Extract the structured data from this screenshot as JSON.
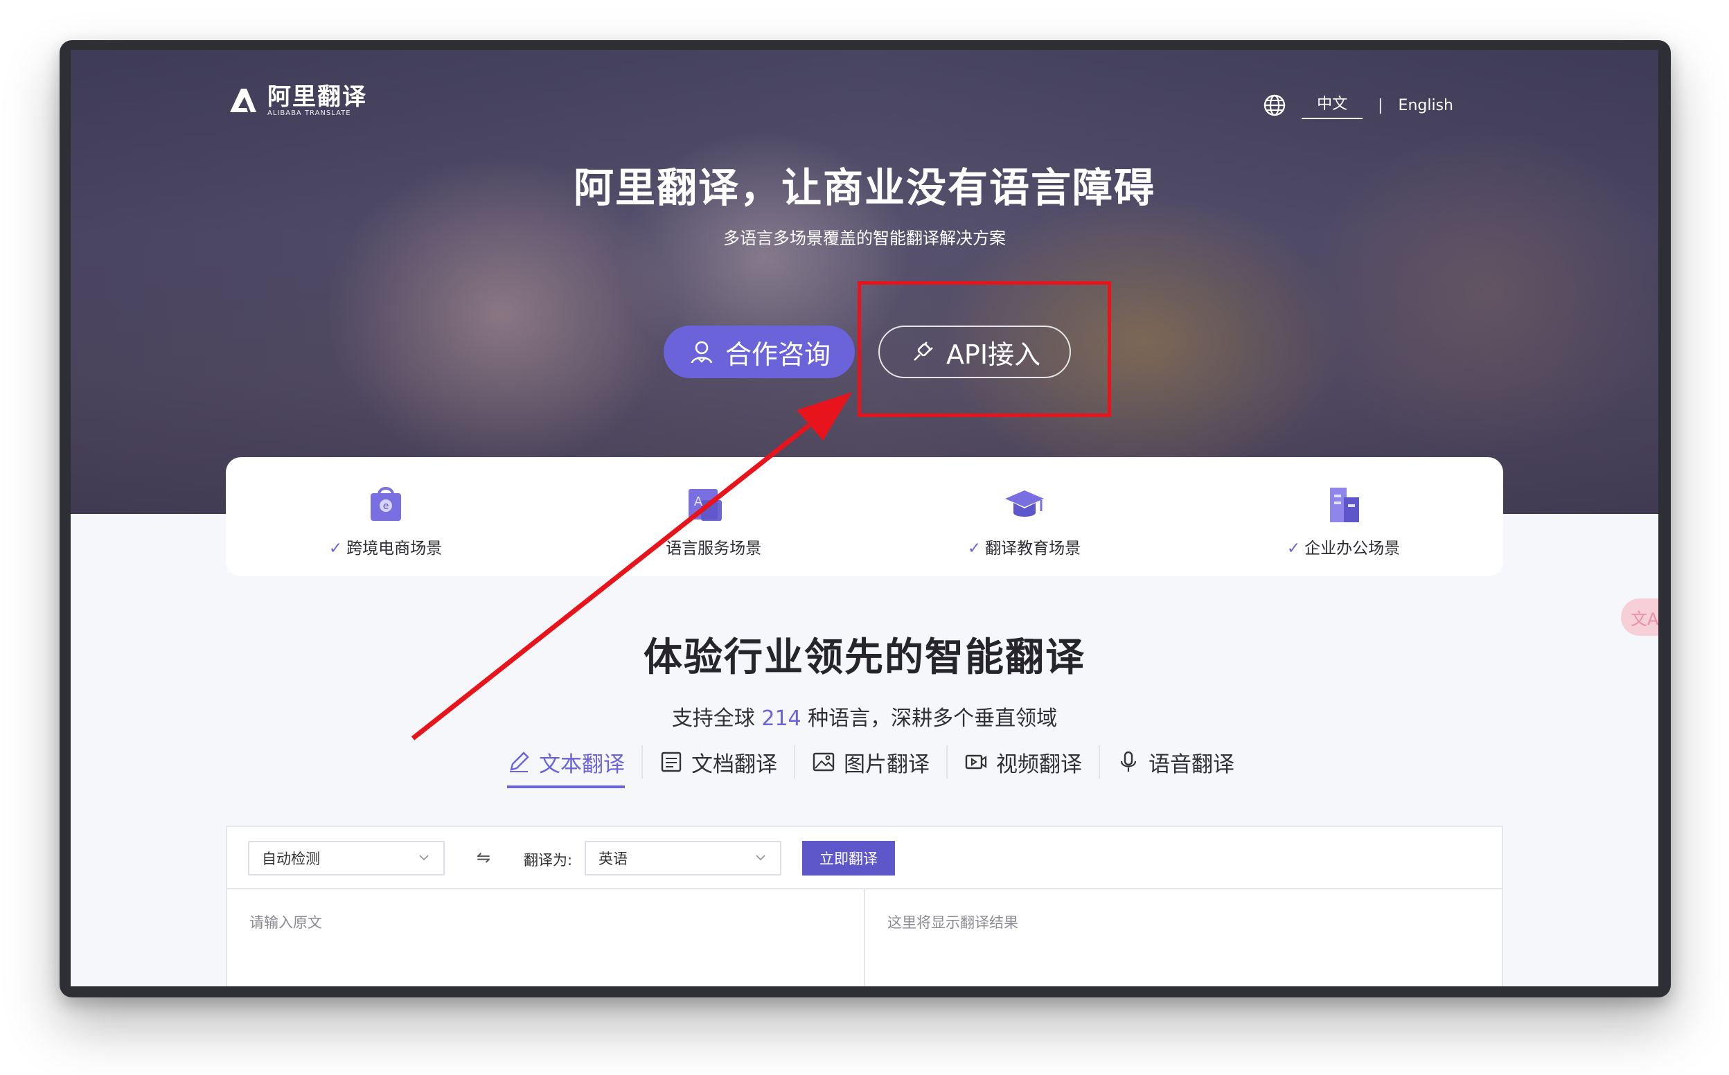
{
  "brand": {
    "name_cn": "阿里翻译",
    "name_en": "ALIBABA TRANSLATE"
  },
  "lang_switch": {
    "current": "中文",
    "separator": "|",
    "other": "English"
  },
  "hero": {
    "title": "阿里翻译，让商业没有语言障碍",
    "subtitle": "多语言多场景覆盖的智能翻译解决方案",
    "consult_label": "合作咨询",
    "api_label": "API接入"
  },
  "scenarios": [
    {
      "label": "跨境电商场景",
      "icon": "shopping-bag-icon"
    },
    {
      "label": "语言服务场景",
      "icon": "language-book-icon"
    },
    {
      "label": "翻译教育场景",
      "icon": "graduation-cap-icon"
    },
    {
      "label": "企业办公场景",
      "icon": "office-building-icon"
    }
  ],
  "side_float_label": "文A",
  "section": {
    "title": "体验行业领先的智能翻译",
    "subtitle_prefix": "支持全球",
    "subtitle_num": "214",
    "subtitle_suffix": "种语言，深耕多个垂直领域"
  },
  "tabs": [
    {
      "label": "文本翻译",
      "icon": "pencil-icon",
      "active": true
    },
    {
      "label": "文档翻译",
      "icon": "document-icon",
      "active": false
    },
    {
      "label": "图片翻译",
      "icon": "image-icon",
      "active": false
    },
    {
      "label": "视频翻译",
      "icon": "video-icon",
      "active": false
    },
    {
      "label": "语音翻译",
      "icon": "microphone-icon",
      "active": false
    }
  ],
  "translator": {
    "source_lang": "自动检测",
    "swap_symbol": "⇋",
    "target_label": "翻译为:",
    "target_lang": "英语",
    "translate_button": "立即翻译",
    "source_placeholder": "请输入原文",
    "result_placeholder": "这里将显示翻译结果"
  },
  "colors": {
    "accent": "#6a63d9",
    "annotation_red": "#e8141c"
  }
}
